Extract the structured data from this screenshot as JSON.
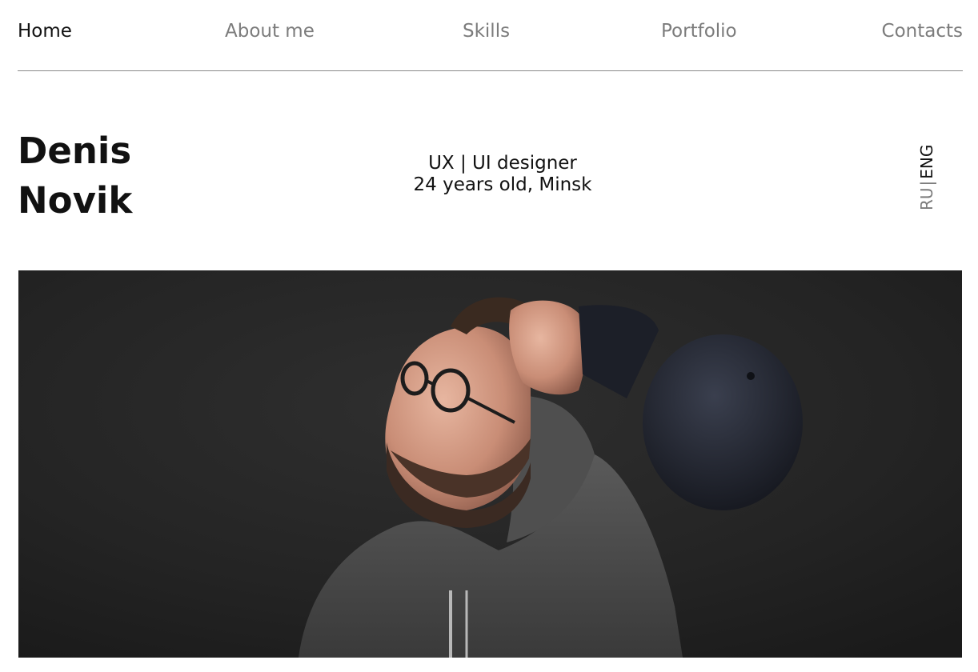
{
  "nav": {
    "items": [
      {
        "label": "Home",
        "active": true
      },
      {
        "label": "About me",
        "active": false
      },
      {
        "label": "Skills",
        "active": false
      },
      {
        "label": "Portfolio",
        "active": false
      },
      {
        "label": "Contacts",
        "active": false
      }
    ]
  },
  "hero": {
    "first_name": "Denis",
    "last_name": "Novik",
    "role": "UX | UI designer",
    "details": "24 years old, Minsk"
  },
  "language": {
    "options": [
      "RU",
      "ENG"
    ],
    "separator": "|",
    "active": "ENG"
  },
  "photo": {
    "subject": "portrait-photo"
  },
  "colors": {
    "text_primary": "#111111",
    "text_muted": "#7c7c7c",
    "divider": "#8a8a8a",
    "photo_background": "#222222"
  }
}
